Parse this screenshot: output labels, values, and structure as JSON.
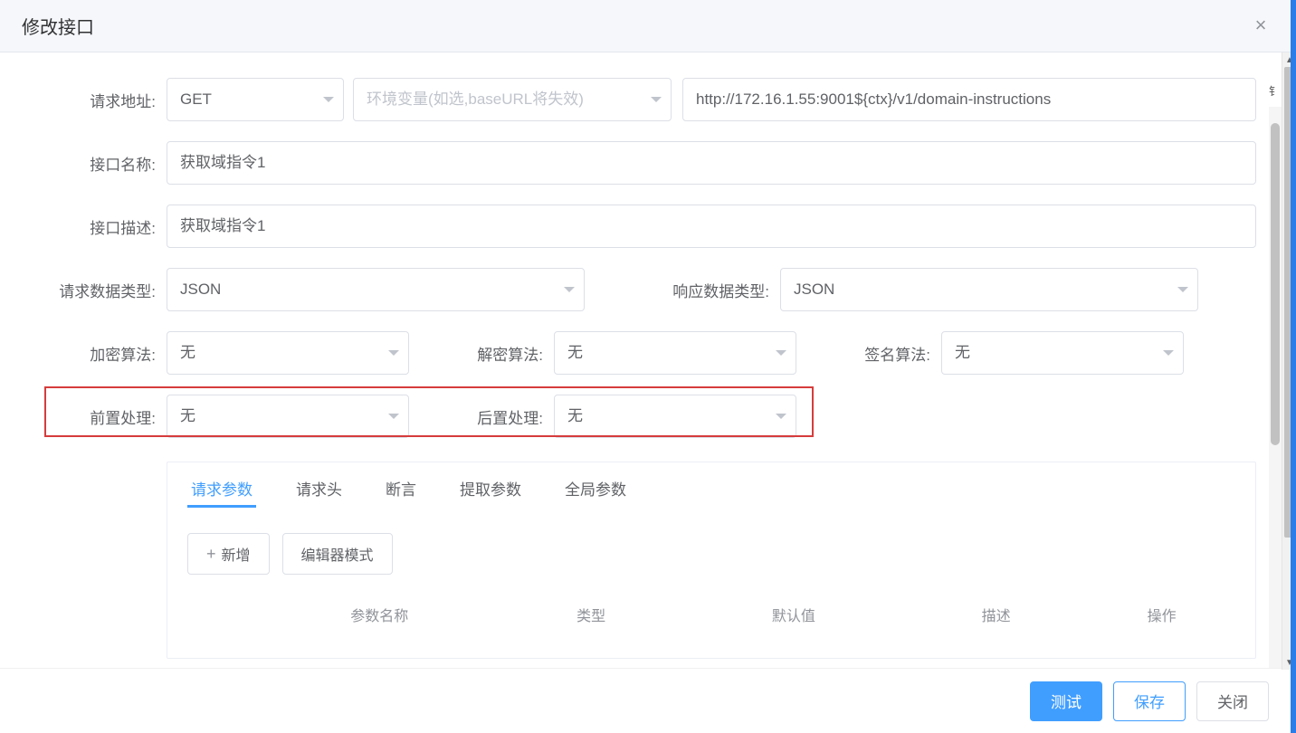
{
  "header": {
    "title": "修改接口"
  },
  "form": {
    "labels": {
      "requestUrl": "请求地址:",
      "apiName": "接口名称:",
      "apiDesc": "接口描述:",
      "reqDataType": "请求数据类型:",
      "resDataType": "响应数据类型:",
      "encAlgo": "加密算法:",
      "decAlgo": "解密算法:",
      "signAlgo": "签名算法:",
      "preProcess": "前置处理:",
      "postProcess": "后置处理:"
    },
    "values": {
      "method": "GET",
      "envVarPlaceholder": "环境变量(如选,baseURL将失效)",
      "url": "http://172.16.1.55:9001${ctx}/v1/domain-instructions",
      "apiName": "获取域指令1",
      "apiDesc": "获取域指令1",
      "reqDataType": "JSON",
      "resDataType": "JSON",
      "encAlgo": "无",
      "decAlgo": "无",
      "signAlgo": "无",
      "preProcess": "无",
      "postProcess": "无"
    }
  },
  "tabs": {
    "items": [
      "请求参数",
      "请求头",
      "断言",
      "提取参数",
      "全局参数"
    ],
    "activeIndex": 0,
    "actions": {
      "add": "新增",
      "editorMode": "编辑器模式"
    },
    "columns": [
      "参数名称",
      "类型",
      "默认值",
      "描述",
      "操作"
    ]
  },
  "footer": {
    "test": "测试",
    "save": "保存",
    "close": "关闭"
  }
}
